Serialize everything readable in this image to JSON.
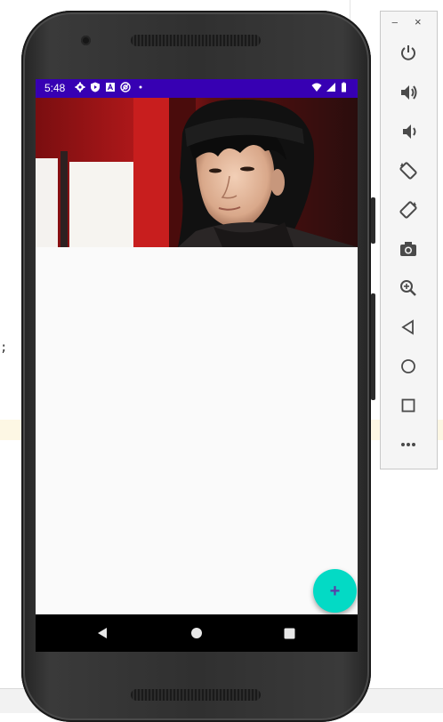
{
  "statusbar": {
    "time": "5:48",
    "icons": [
      "gear-icon",
      "play-protect-icon",
      "a-icon",
      "at-icon",
      "dot-icon"
    ],
    "right_icons": [
      "wifi-icon",
      "signal-icon",
      "battery-icon"
    ],
    "color": "#3700b3"
  },
  "photo": {
    "kind": "photo",
    "description": ""
  },
  "fab": {
    "label": "+",
    "icon": "plus-icon",
    "color": "#03dac5"
  },
  "navbar": {
    "items": [
      "back-icon",
      "home-icon",
      "recents-icon"
    ]
  },
  "emulator_panel": {
    "window_controls": {
      "minimize": "−",
      "close": "×"
    },
    "controls": [
      "power-icon",
      "volume-up-icon",
      "volume-down-icon",
      "rotate-left-icon",
      "rotate-right-icon",
      "camera-icon",
      "zoom-icon",
      "back-icon",
      "home-icon",
      "overview-icon",
      "more-icon"
    ],
    "more_label": "•••"
  },
  "ide": {
    "fragment_text": ";"
  }
}
